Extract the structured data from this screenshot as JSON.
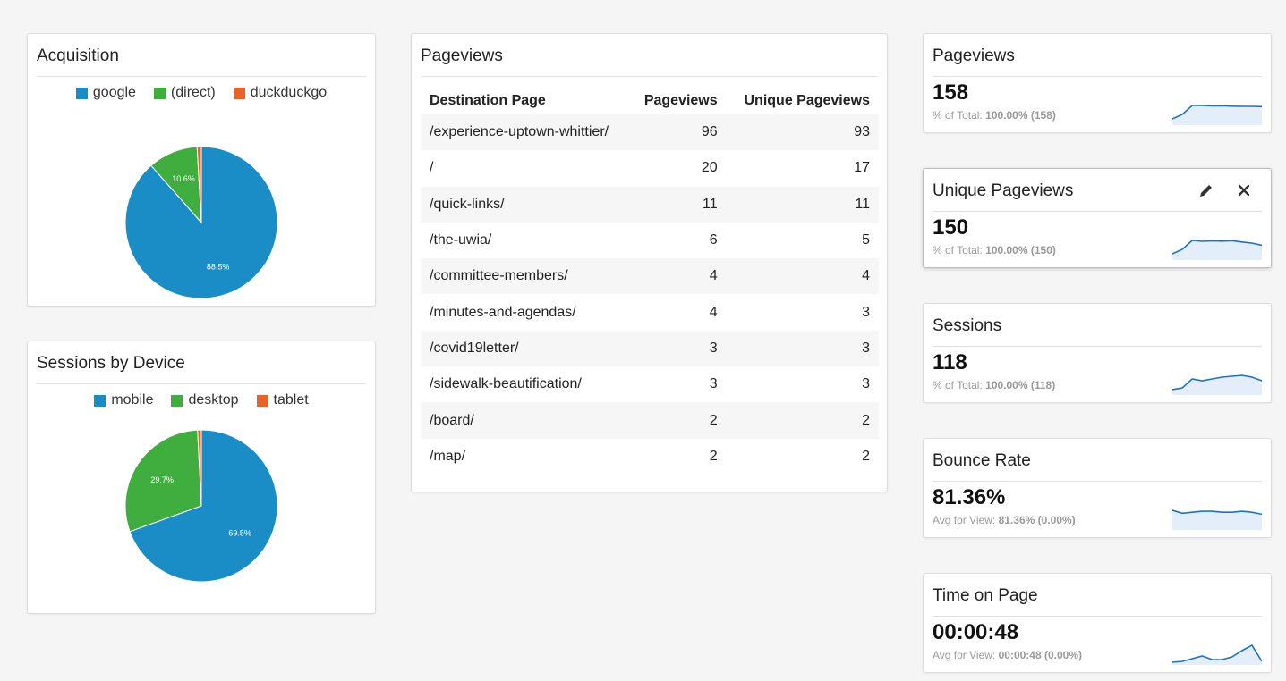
{
  "colors": {
    "blue": "#1a8dc7",
    "green": "#3fae3f",
    "orange": "#e8622a",
    "spark": "#1a73c8",
    "spark_fill": "#e3eefa"
  },
  "acquisition": {
    "title": "Acquisition",
    "legend": [
      {
        "label": "google",
        "color": "#1a8dc7"
      },
      {
        "label": "(direct)",
        "color": "#3fae3f"
      },
      {
        "label": "duckduckgo",
        "color": "#e8622a"
      }
    ],
    "slice_labels": [
      "88.5%",
      "10.6%"
    ]
  },
  "sessions_by_device": {
    "title": "Sessions by Device",
    "legend": [
      {
        "label": "mobile",
        "color": "#1a8dc7"
      },
      {
        "label": "desktop",
        "color": "#3fae3f"
      },
      {
        "label": "tablet",
        "color": "#e8622a"
      }
    ],
    "slice_labels": [
      "69.5%",
      "29.7%"
    ]
  },
  "pageviews_table": {
    "title": "Pageviews",
    "headers": [
      "Destination Page",
      "Pageviews",
      "Unique Pageviews"
    ],
    "rows": [
      [
        "/experience-uptown-whittier/",
        "96",
        "93"
      ],
      [
        "/",
        "20",
        "17"
      ],
      [
        "/quick-links/",
        "11",
        "11"
      ],
      [
        "/the-uwia/",
        "6",
        "5"
      ],
      [
        "/committee-members/",
        "4",
        "4"
      ],
      [
        "/minutes-and-agendas/",
        "4",
        "3"
      ],
      [
        "/covid19letter/",
        "3",
        "3"
      ],
      [
        "/sidewalk-beautification/",
        "3",
        "3"
      ],
      [
        "/board/",
        "2",
        "2"
      ],
      [
        "/map/",
        "2",
        "2"
      ]
    ]
  },
  "metrics": [
    {
      "title": "Pageviews",
      "value": "158",
      "sub_label": "% of Total:",
      "sub_value": "100.00% (158)",
      "spark": [
        2,
        4,
        8,
        8,
        7.8,
        7.9,
        7.7,
        7.6,
        7.6,
        7.5
      ]
    },
    {
      "title": "Unique Pageviews",
      "value": "150",
      "sub_label": "% of Total:",
      "sub_value": "100.00% (150)",
      "spark": [
        2,
        4,
        8,
        7.6,
        7.8,
        7.7,
        7.9,
        7.3,
        6.8,
        5.8
      ]
    },
    {
      "title": "Sessions",
      "value": "118",
      "sub_label": "% of Total:",
      "sub_value": "100.00% (118)",
      "spark": [
        2,
        3,
        8,
        7,
        8,
        9,
        9.5,
        10,
        9,
        7
      ]
    },
    {
      "title": "Bounce Rate",
      "value": "81.36%",
      "sub_label": "Avg for View:",
      "sub_value": "81.36% (0.00%)",
      "spark": [
        9,
        7.5,
        8,
        8.5,
        8.5,
        8,
        8,
        8.5,
        8,
        7
      ]
    },
    {
      "title": "Time on Page",
      "value": "00:00:48",
      "sub_label": "Avg for View:",
      "sub_value": "00:00:48 (0.00%)",
      "spark": [
        1,
        2,
        5,
        8,
        4,
        4,
        7,
        14,
        20,
        2
      ]
    }
  ],
  "chart_data": [
    {
      "type": "pie",
      "title": "Acquisition",
      "categories": [
        "google",
        "(direct)",
        "duckduckgo"
      ],
      "values": [
        88.5,
        10.6,
        0.9
      ]
    },
    {
      "type": "pie",
      "title": "Sessions by Device",
      "categories": [
        "mobile",
        "desktop",
        "tablet"
      ],
      "values": [
        69.5,
        29.7,
        0.8
      ]
    }
  ]
}
